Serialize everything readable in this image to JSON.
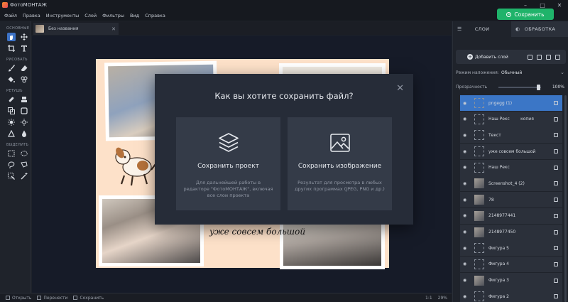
{
  "app": {
    "title": "ФотоМОНТАЖ",
    "save_button": "Сохранить"
  },
  "menu": [
    "Файл",
    "Правка",
    "Инструменты",
    "Слой",
    "Фильтры",
    "Вид",
    "Справка"
  ],
  "toolbox": {
    "groups": [
      "ОСНОВНЫЕ",
      "РИСОВАТЬ",
      "РЕТУШЬ",
      "ВЫДЕЛИТЬ"
    ]
  },
  "document_tab": {
    "name": "Без названия"
  },
  "canvas": {
    "caption": "уже совсем большой"
  },
  "status_bar": {
    "open": "Открыть",
    "prev": "Перенести",
    "save": "Сохранить",
    "ratio": "1:1",
    "zoom": "29%"
  },
  "dialog": {
    "title": "Как вы хотите сохранить файл?",
    "options": [
      {
        "title": "Сохранить проект",
        "description": "Для дальнейшей работы в редакторе \"ФотоМОНТАЖ\", включая все слои проекта"
      },
      {
        "title": "Сохранить изображение",
        "description": "Результат для просмотра в любых других программах (JPEG, PNG и др.)"
      }
    ]
  },
  "panel": {
    "tabs": [
      "СЛОИ",
      "ОБРАБОТКА"
    ],
    "add_layer": "Добавить слой",
    "blend_mode_label": "Режим наложения:",
    "blend_mode_value": "Обычный",
    "opacity_label": "Прозрачность",
    "opacity_value": "100%",
    "opacity_fraction": 1.0,
    "layers": [
      {
        "name": "pngegg (1)",
        "selected": true
      },
      {
        "name": "Наш Рекс        копия",
        "selected": false
      },
      {
        "name": "Текст",
        "selected": false
      },
      {
        "name": "уже совсем большой",
        "selected": false
      },
      {
        "name": "Наш Рекс",
        "selected": false
      },
      {
        "name": "Screenshot_4 (2)",
        "selected": false
      },
      {
        "name": "78",
        "selected": false
      },
      {
        "name": "2148977441",
        "selected": false
      },
      {
        "name": "2148977450",
        "selected": false
      },
      {
        "name": "Фигура 5",
        "selected": false
      },
      {
        "name": "Фигура 4",
        "selected": false
      },
      {
        "name": "Фигура 3",
        "selected": false
      },
      {
        "name": "Фигура 2",
        "selected": false
      }
    ]
  },
  "colors": {
    "accent_green": "#1fb36a",
    "selection_blue": "#3b76c6",
    "canvas_bg": "#fde1c9"
  }
}
